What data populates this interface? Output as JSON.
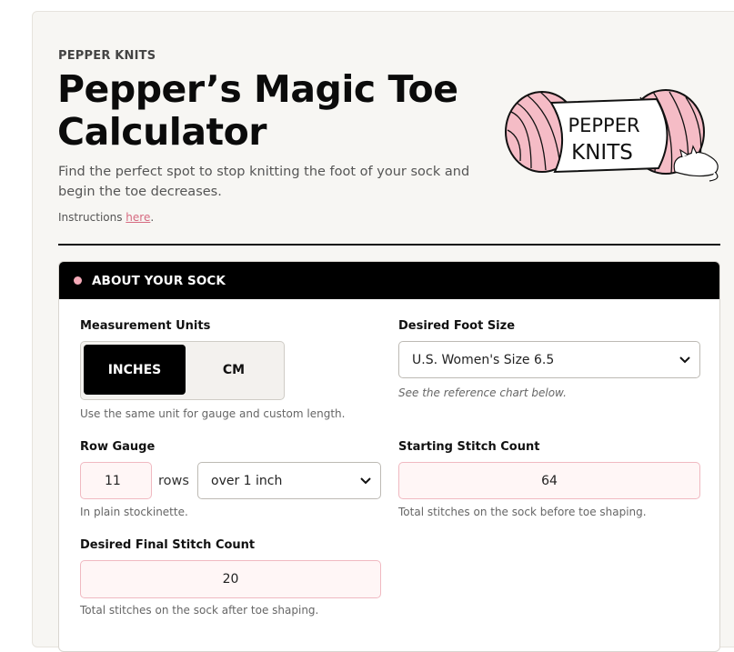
{
  "brand": "PEPPER KNITS",
  "title": "Pepper’s Magic Toe Calculator",
  "subtitle": "Find the perfect spot to stop knitting the foot of your sock and begin the toe decreases.",
  "instructions": {
    "prefix": "Instructions ",
    "link": "here",
    "suffix": "."
  },
  "logo": {
    "line1": "PEPPER",
    "line2": "KNITS",
    "yarn_color": "#f5bcc6"
  },
  "section": {
    "title": "ABOUT YOUR SOCK",
    "dot_color": "#f5aab8"
  },
  "units": {
    "label": "Measurement Units",
    "options": [
      "INCHES",
      "CM"
    ],
    "selected": "INCHES",
    "help": "Use the same unit for gauge and custom length."
  },
  "foot_size": {
    "label": "Desired Foot Size",
    "selected": "U.S. Women's Size 6.5",
    "help": "See the reference chart below."
  },
  "row_gauge": {
    "label": "Row Gauge",
    "value": "11",
    "unit_text": "rows",
    "per_selected": "over 1 inch",
    "help": "In plain stockinette."
  },
  "starting_stitches": {
    "label": "Starting Stitch Count",
    "value": "64",
    "help": "Total stitches on the sock before toe shaping."
  },
  "final_stitches": {
    "label": "Desired Final Stitch Count",
    "value": "20",
    "help": "Total stitches on the sock after toe shaping."
  }
}
